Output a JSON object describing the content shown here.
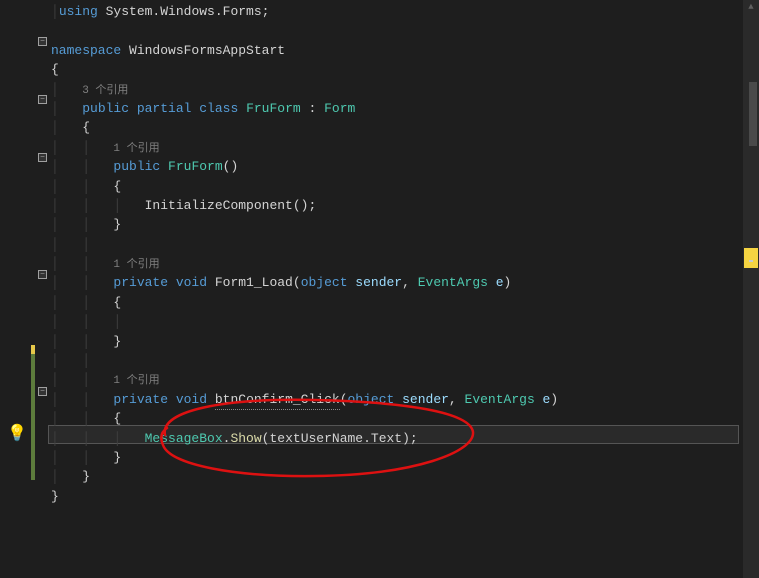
{
  "code": {
    "line1_using": "using",
    "line1_text": " System.Windows.Forms;",
    "line3_namespace": "namespace",
    "line3_name": " WindowsFormsAppStart",
    "line4_brace": "{",
    "line5_hint": "3 个引用",
    "line6_public": "public",
    "line6_partial": " partial",
    "line6_class": " class",
    "line6_name": " FruForm",
    "line6_colon": " : ",
    "line6_base": "Form",
    "line7_brace": "{",
    "line8_hint": "1 个引用",
    "line9_public": "public",
    "line9_name": " FruForm",
    "line9_parens": "()",
    "line10_brace": "{",
    "line11_call": "InitializeComponent",
    "line11_end": "();",
    "line12_brace": "}",
    "line14_hint": "1 个引用",
    "line15_private": "private",
    "line15_void": " void",
    "line15_name": " Form1_Load",
    "line15_open": "(",
    "line15_objtype": "object",
    "line15_sender": " sender",
    "line15_comma": ", ",
    "line15_evtype": "EventArgs",
    "line15_e": " e",
    "line15_close": ")",
    "line16_brace": "{",
    "line18_brace": "}",
    "line20_hint": "1 个引用",
    "line21_private": "private",
    "line21_void": " void",
    "line21_name": " btnConfirm_Click",
    "line21_open": "(",
    "line21_objtype": "object",
    "line21_sender": " sender",
    "line21_comma": ", ",
    "line21_evtype": "EventArgs",
    "line21_e": " e",
    "line21_close": ")",
    "line22_brace": "{",
    "line23_msgbox": "MessageBox",
    "line23_dot": ".",
    "line23_show": "Show",
    "line23_open": "(",
    "line23_arg": "textUserName.Text",
    "line23_close": ");",
    "line24_brace": "}",
    "line25_brace": "}",
    "line26_brace": "}"
  },
  "indent": {
    "i0": "",
    "i1": "    ",
    "i2": "        ",
    "i3": "            "
  }
}
